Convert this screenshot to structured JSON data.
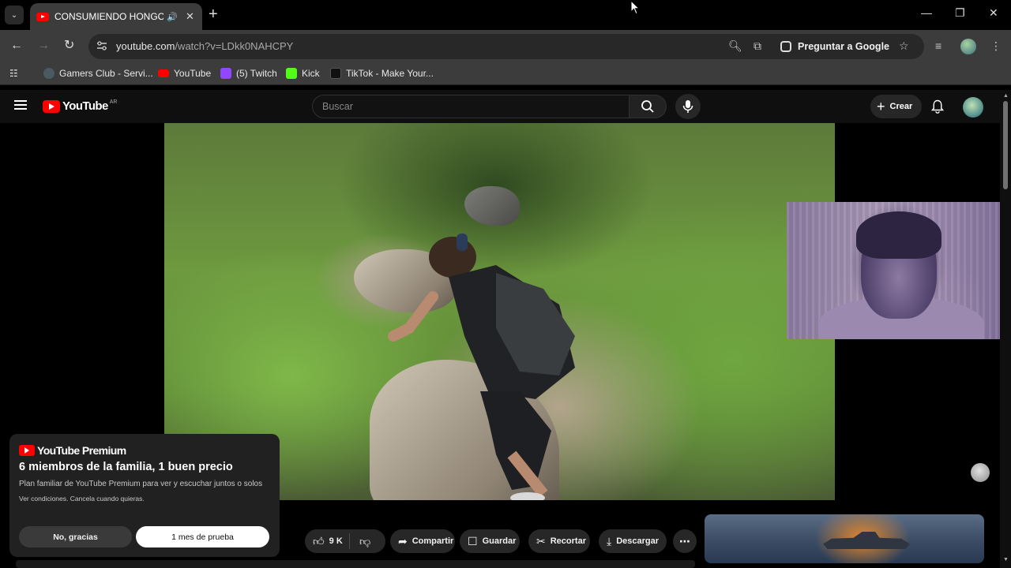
{
  "browser": {
    "tab": {
      "title": "CONSUMIENDO HONGOS |",
      "favicon": "youtube-icon",
      "audio_icon": "speaker-icon"
    },
    "address": {
      "host": "youtube.com",
      "path": "/watch?v=LDkk0NAHCPY"
    },
    "ask_google_label": "Preguntar a Google",
    "bookmarks": [
      {
        "label": "Gamers Club - Servi...",
        "icon": "gamers-club-icon",
        "color": "#4a5a60"
      },
      {
        "label": "YouTube",
        "icon": "youtube-icon",
        "color": "#ff0000"
      },
      {
        "label": "(5) Twitch",
        "icon": "twitch-icon",
        "color": "#9146ff"
      },
      {
        "label": "Kick",
        "icon": "kick-icon",
        "color": "#53fc18"
      },
      {
        "label": "TikTok - Make Your...",
        "icon": "tiktok-icon",
        "color": "#111111"
      }
    ]
  },
  "youtube": {
    "logo_text": "YouTube",
    "country_code": "AR",
    "search_placeholder": "Buscar",
    "create_label": "Crear"
  },
  "promo": {
    "brand": "YouTube Premium",
    "title": "6 miembros de la familia, 1 buen precio",
    "description": "Plan familiar de YouTube Premium para ver y escuchar juntos o solos",
    "terms": "Ver condiciones. Cancela cuando quieras.",
    "decline_label": "No, gracias",
    "trial_label": "1 mes de prueba"
  },
  "actions": {
    "likes": "9 K",
    "share": "Compartir",
    "save": "Guardar",
    "clip": "Recortar",
    "download": "Descargar"
  },
  "colors": {
    "accent": "#ff0000",
    "background": "#0f0f0f",
    "chrome": "#3c3c3c"
  }
}
